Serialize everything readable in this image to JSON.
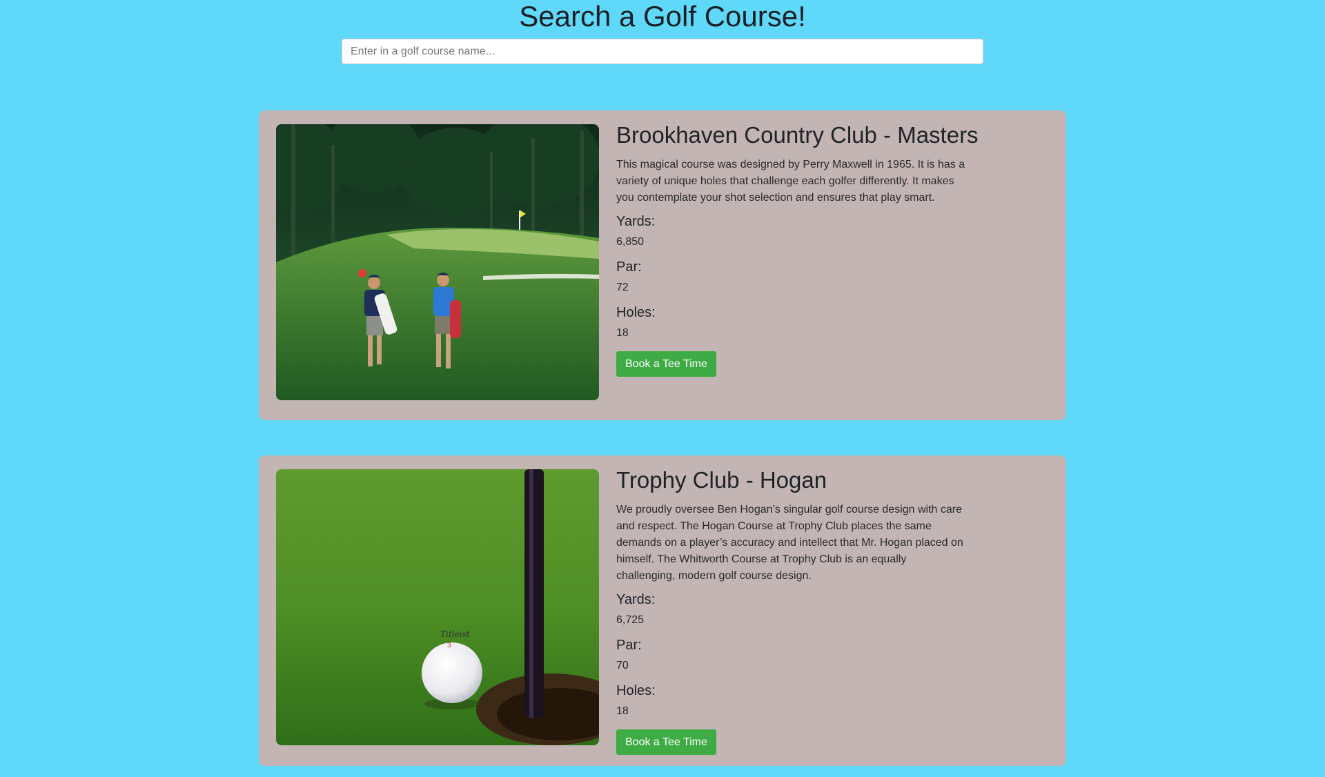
{
  "header": {
    "title": "Search a Golf Course!"
  },
  "search": {
    "placeholder": "Enter in a golf course name...",
    "value": ""
  },
  "courses": [
    {
      "name": "Brookhaven Country Club - Masters",
      "description": "This magical course was designed by Perry Maxwell in 1965. It is has a variety of unique holes that challenge each golfer differently. It makes you contemplate your shot selection and ensures that play smart.",
      "yards_label": "Yards:",
      "yards": "6,850",
      "par_label": "Par:",
      "par": "72",
      "holes_label": "Holes:",
      "holes": "18",
      "button_label": "Book a Tee Time",
      "image": "golfers-walking-fairway-photo"
    },
    {
      "name": "Trophy Club - Hogan",
      "description": "We proudly oversee Ben Hogan’s singular golf course design with care and respect. The Hogan Course at Trophy Club places the same demands on a player’s accuracy and intellect that Mr. Hogan placed on himself. The Whitworth Course at Trophy Club is an equally challenging, modern golf course design.",
      "yards_label": "Yards:",
      "yards": "6,725",
      "par_label": "Par:",
      "par": "70",
      "holes_label": "Holes:",
      "holes": "18",
      "button_label": "Book a Tee Time",
      "image": "golf-ball-by-cup-photo",
      "ball_brand": "Titleist"
    }
  ],
  "colors": {
    "background": "#5fd8f9",
    "card": "#c2b5b4",
    "button": "#3fab45"
  }
}
